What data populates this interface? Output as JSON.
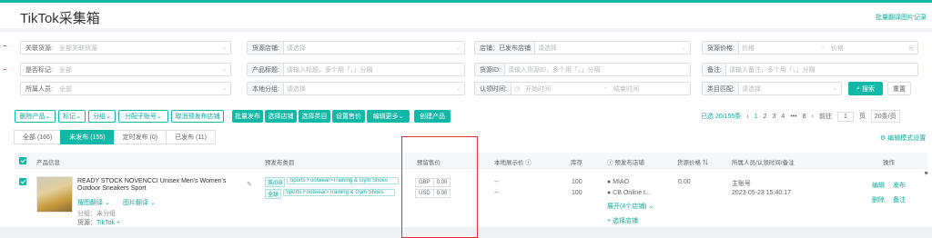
{
  "page_title": "TikTok采集箱",
  "batch_link": "批量翻译图片记录",
  "filters": {
    "source_label": "关联货源:",
    "source_ph": "全部关联货源",
    "warehouse_label": "货源店铺:",
    "warehouse_ph": "请选择",
    "store_label": "店铺：已发布店铺",
    "store_ph": "请选择",
    "price_label": "货源价格:",
    "price_min_ph": "价格",
    "price_max_ph": "价格",
    "price_unit": "元",
    "tag_label": "是否标记:",
    "tag_ph": "全部",
    "product_title_label": "产品标题:",
    "product_title_ph": "请输入标题，多个用「，」分隔",
    "goods_id_label": "货源ID:",
    "goods_id_ph": "请输入货源ID，多个用「，」分隔",
    "note_label": "备注:",
    "note_ph": "请输入备注，多个用「，」分隔",
    "owner_label": "所属人员:",
    "owner_ph": "全部",
    "local_cat_label": "本地分组:",
    "local_cat_ph": "请选择",
    "time_label": "认领时间:",
    "time_start_ph": "开始时间",
    "time_end_ph": "结束时间",
    "cat_match_label": "类目匹配:",
    "cat_match_ph": "请选择",
    "search_btn": "搜索",
    "reset_btn": "重置"
  },
  "actions": {
    "delete": "删除产品",
    "mark": "标记",
    "group": "分组",
    "assign": "分配子账号",
    "cancel_pre": "取消预发布店铺",
    "batch_publish": "批量发布",
    "select_store": "选择店铺",
    "select_cat": "选择类目",
    "set_price": "设置售价",
    "edit_more": "编辑更多",
    "create": "创建产品"
  },
  "pager": {
    "selected": "已选 20/155条",
    "pages": [
      "1",
      "2",
      "3",
      "4",
      "•••",
      "8"
    ],
    "goto": "前往",
    "page_val": "1",
    "page_unit": "页",
    "per_page": "20条/页"
  },
  "tabs": [
    {
      "label": "全部 (166)",
      "active": false
    },
    {
      "label": "未发布 (155)",
      "active": true
    },
    {
      "label": "定时发布 (0)",
      "active": false
    },
    {
      "label": "已发布 (11)",
      "active": false
    }
  ],
  "edit_mode": "编辑模式设置",
  "headers": {
    "info": "产品信息",
    "cat": "预发布类目",
    "price": "预留售价",
    "local_price": "本地展示价",
    "stock": "库存",
    "pre_store": "预发布店铺",
    "src_price": "货源价格",
    "owner": "所属人员/认领时间/备注",
    "ops": "操作"
  },
  "row": {
    "title_line1": "READY STOCK NOVENCCI Unisex Men's Women's",
    "title_line2": "Outdoor Sneakers Sport",
    "link1": "搜图翻译",
    "link2": "图片翻译",
    "group": "分组：未分组",
    "source_label": "货源：",
    "source": "TikTok",
    "regions": [
      {
        "tag": "英/GB",
        "cat": "Sports Footwear>Training & Gym Shoes",
        "cur": "GBP",
        "price": "0.00",
        "local": "--",
        "stock": "100",
        "store": "MIAO"
      },
      {
        "tag": "全球",
        "cat": "Sports Footwear>Training & Gym Shoes",
        "cur": "USD",
        "price": "0.00",
        "local": "--",
        "stock": "100",
        "store": "CB Online t..."
      }
    ],
    "expand": "展开(4个店铺)",
    "choose_store": "选择店铺",
    "src_price": "0.00",
    "owner": "主账号",
    "time": "2023-05-23 15:40:17",
    "op_edit": "编辑",
    "op_publish": "发布",
    "op_delete": "删除",
    "op_note": "备注"
  },
  "colors": {
    "accent": "#14b8a6",
    "highlight": "#e0332f"
  }
}
